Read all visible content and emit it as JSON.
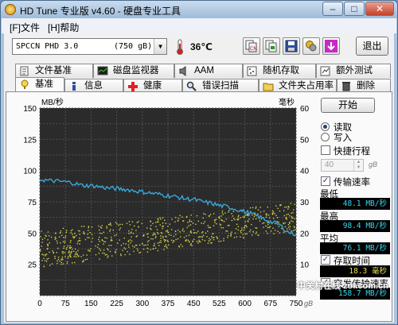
{
  "window": {
    "title": "HD Tune 专业版 v4.60 - 硬盘专业工具"
  },
  "menu": {
    "file": "[F]文件",
    "help": "[H]帮助"
  },
  "toolbar": {
    "drive_name": "SPCCN   PHD 3.0",
    "drive_capacity": "(750 gB)",
    "temperature": "36℃",
    "exit_label": "退出"
  },
  "tabs_row1": [
    {
      "label": "文件基准",
      "icon": "file-benchmark-icon"
    },
    {
      "label": "磁盘监视器",
      "icon": "disk-monitor-icon"
    },
    {
      "label": "AAM",
      "icon": "speaker-icon"
    },
    {
      "label": "随机存取",
      "icon": "random-access-icon"
    },
    {
      "label": "额外测试",
      "icon": "extra-tests-icon"
    }
  ],
  "tabs_row2": [
    {
      "label": "基准",
      "icon": "benchmark-icon"
    },
    {
      "label": "信息",
      "icon": "info-icon"
    },
    {
      "label": "健康",
      "icon": "health-cross-icon"
    },
    {
      "label": "错误扫描",
      "icon": "error-scan-icon"
    },
    {
      "label": "文件夹占用率",
      "icon": "folder-usage-icon"
    },
    {
      "label": "删除",
      "icon": "erase-icon"
    }
  ],
  "controls": {
    "start_label": "开始",
    "read_label": "读取",
    "write_label": "写入",
    "short_stroke_label": "快捷行程",
    "short_stroke_value": "40",
    "short_stroke_unit": "gB",
    "transfer_rate_label": "传输速率",
    "min_label": "最低",
    "min_value": "48.1 MB/秒",
    "max_label": "最高",
    "max_value": "98.4 MB/秒",
    "avg_label": "平均",
    "avg_value": "76.1 MB/秒",
    "access_time_label": "存取时间",
    "access_time_value": "18.3 毫秒",
    "burst_rate_label": "突发传输速率",
    "burst_rate_value": "158.7 MB/秒",
    "read_selected": true,
    "short_stroke_checked": false,
    "transfer_checked": true,
    "access_checked": true,
    "burst_checked": true
  },
  "watermark": "中关村在线 zol.com.cn",
  "colors": {
    "chart_bg": "#2b2b2b",
    "grid": "#4f4f4f",
    "transfer_line": "#3aa7d8",
    "access_dots": "#d8d24a",
    "readout_cyan": "#38d7f0",
    "readout_yellow": "#e8e04a"
  },
  "chart_data": {
    "type": "line",
    "ylabel_left": "MB/秒",
    "ylabel_right": "毫秒",
    "xlabel": "gB",
    "x_ticks": [
      "0",
      "75",
      "150",
      "225",
      "300",
      "375",
      "450",
      "525",
      "600",
      "675",
      "750"
    ],
    "y_ticks_left": [
      "150",
      "125",
      "100",
      "75",
      "50",
      "25"
    ],
    "y_ticks_right": [
      "60",
      "50",
      "40",
      "30",
      "20",
      "10"
    ],
    "xlim": [
      0,
      750
    ],
    "ylim_left": [
      0,
      150
    ],
    "ylim_right": [
      0,
      60
    ],
    "series": [
      {
        "axis": "left",
        "x": [
          0,
          25,
          50,
          75,
          100,
          125,
          150,
          175,
          200,
          225,
          250,
          275,
          300,
          325,
          350,
          375,
          400,
          425,
          450,
          475,
          500,
          525,
          550,
          575,
          600,
          625,
          650,
          675,
          700,
          725,
          750
        ],
        "values": [
          93,
          92,
          91.5,
          91,
          90,
          88,
          88,
          87,
          86,
          85.5,
          85,
          84,
          83,
          82,
          81,
          80,
          79,
          77.5,
          77,
          75,
          74,
          72,
          71,
          69,
          67,
          65,
          62,
          59,
          57,
          51,
          49
        ]
      }
    ],
    "scatter": {
      "axis": "right",
      "description_values": "access time samples",
      "x_range": [
        0,
        750
      ],
      "y_start_range": [
        9,
        21
      ],
      "y_end_range": [
        21,
        30
      ]
    }
  }
}
